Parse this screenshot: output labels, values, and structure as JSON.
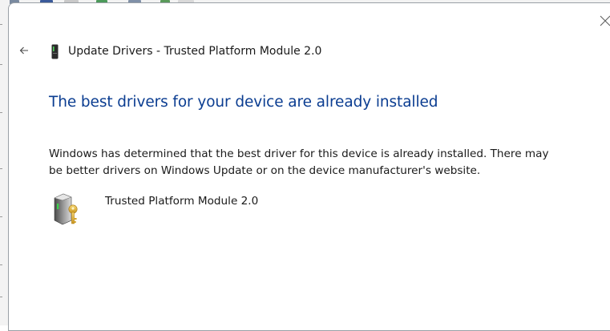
{
  "dialog": {
    "title": "Update Drivers - Trusted Platform Module 2.0",
    "heading": "The best drivers for your device are already installed",
    "description": "Windows has determined that the best driver for this device is already installed. There may be better drivers on Windows Update or on the device manufacturer's website.",
    "device_name": "Trusted Platform Module 2.0",
    "icons": {
      "back": "back-arrow-icon",
      "close": "close-icon",
      "title": "tpm-chip-icon",
      "device": "tpm-device-key-icon"
    },
    "colors": {
      "heading": "#0b3d91",
      "text": "#1a1a1a",
      "background": "#ffffff"
    }
  }
}
